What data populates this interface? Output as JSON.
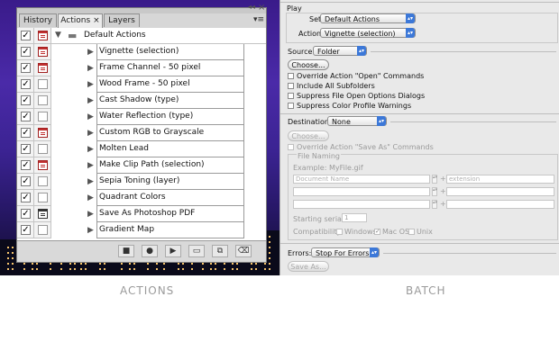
{
  "actions_panel": {
    "tabs": [
      {
        "label": "History",
        "active": false
      },
      {
        "label": "Actions",
        "active": true
      },
      {
        "label": "Layers",
        "active": false
      }
    ],
    "set_name": "Default Actions",
    "items": [
      {
        "label": "Vignette (selection)",
        "checked": true,
        "dialog": "red"
      },
      {
        "label": "Frame Channel - 50 pixel",
        "checked": true,
        "dialog": "red"
      },
      {
        "label": "Wood Frame - 50 pixel",
        "checked": true,
        "dialog": "none"
      },
      {
        "label": "Cast Shadow (type)",
        "checked": true,
        "dialog": "none"
      },
      {
        "label": "Water Reflection (type)",
        "checked": true,
        "dialog": "none"
      },
      {
        "label": "Custom RGB to Grayscale",
        "checked": true,
        "dialog": "red"
      },
      {
        "label": "Molten Lead",
        "checked": true,
        "dialog": "none"
      },
      {
        "label": "Make Clip Path (selection)",
        "checked": true,
        "dialog": "red"
      },
      {
        "label": "Sepia Toning (layer)",
        "checked": true,
        "dialog": "none"
      },
      {
        "label": "Quadrant Colors",
        "checked": true,
        "dialog": "none"
      },
      {
        "label": "Save As Photoshop PDF",
        "checked": true,
        "dialog": "dark"
      },
      {
        "label": "Gradient Map",
        "checked": true,
        "dialog": "none"
      }
    ],
    "close_glyph": "×",
    "bottom_icons": [
      "stop-icon",
      "record-icon",
      "play-icon",
      "new-set-folder-icon",
      "new-action-icon",
      "trash-icon"
    ]
  },
  "captions": {
    "actions": "ACTIONS",
    "batch": "BATCH"
  },
  "batch": {
    "play": {
      "title": "Play",
      "set_label": "Set:",
      "set_value": "Default Actions",
      "action_label": "Action:",
      "action_value": "Vignette (selection)"
    },
    "source": {
      "label": "Source:",
      "value": "Folder",
      "choose_label": "Choose...",
      "options": [
        "Override Action \"Open\" Commands",
        "Include All Subfolders",
        "Suppress File Open Options Dialogs",
        "Suppress Color Profile Warnings"
      ]
    },
    "destination": {
      "label": "Destination:",
      "value": "None",
      "choose_label": "Choose...",
      "override_label": "Override Action \"Save As\" Commands",
      "file_naming_title": "File Naming",
      "example": "Example: MyFile.gif",
      "field1_placeholder": "Document Name",
      "field2_placeholder": "extension",
      "serial_label": "Starting serial#:",
      "serial_value": "1",
      "compat_label": "Compatibility:",
      "compat_windows": "Windows",
      "compat_macos": "Mac OS",
      "compat_unix": "Unix"
    },
    "errors": {
      "label": "Errors:",
      "value": "Stop For Errors",
      "save_as_label": "Save As..."
    }
  }
}
